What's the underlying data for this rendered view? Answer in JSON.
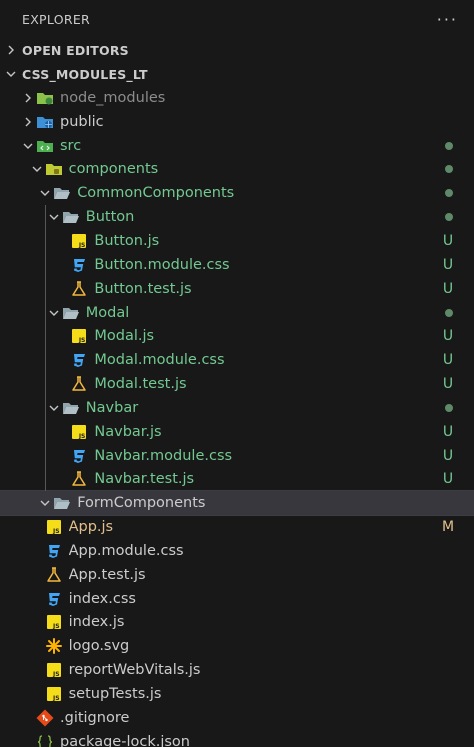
{
  "header": {
    "title": "EXPLORER",
    "more": "···"
  },
  "sections": {
    "open_editors": "OPEN EDITORS",
    "project": "CSS_MODULES_LT"
  },
  "colors": {
    "untracked": "#73c991",
    "modified": "#e2c08d",
    "muted": "#8c8c8c",
    "dot": "#6e6e6e"
  },
  "tree": [
    {
      "label": "node_modules",
      "depth": 1,
      "kind": "folder",
      "icon": "node-folder-icon",
      "open": false,
      "tone": "muted"
    },
    {
      "label": "public",
      "depth": 1,
      "kind": "folder",
      "icon": "public-folder-icon",
      "open": false,
      "tone": "plain"
    },
    {
      "label": "src",
      "depth": 1,
      "kind": "folder",
      "icon": "src-folder-icon",
      "open": true,
      "tone": "untracked",
      "dot": true
    },
    {
      "label": "components",
      "depth": 2,
      "kind": "folder",
      "icon": "components-folder-icon",
      "open": true,
      "tone": "untracked",
      "dot": true
    },
    {
      "label": "CommonComponents",
      "depth": 3,
      "kind": "folder",
      "icon": "folder-open-icon",
      "open": true,
      "tone": "untracked",
      "dot": true
    },
    {
      "label": "Button",
      "depth": 4,
      "kind": "folder",
      "icon": "folder-open-icon",
      "open": true,
      "tone": "untracked",
      "dot": true
    },
    {
      "label": "Button.js",
      "depth": 5,
      "kind": "file",
      "icon": "js-file-icon",
      "tone": "untracked",
      "status": "U"
    },
    {
      "label": "Button.module.css",
      "depth": 5,
      "kind": "file",
      "icon": "css-file-icon",
      "tone": "untracked",
      "status": "U"
    },
    {
      "label": "Button.test.js",
      "depth": 5,
      "kind": "file",
      "icon": "test-file-icon",
      "tone": "untracked",
      "status": "U"
    },
    {
      "label": "Modal",
      "depth": 4,
      "kind": "folder",
      "icon": "folder-open-icon",
      "open": true,
      "tone": "untracked",
      "dot": true
    },
    {
      "label": "Modal.js",
      "depth": 5,
      "kind": "file",
      "icon": "js-file-icon",
      "tone": "untracked",
      "status": "U"
    },
    {
      "label": "Modal.module.css",
      "depth": 5,
      "kind": "file",
      "icon": "css-file-icon",
      "tone": "untracked",
      "status": "U"
    },
    {
      "label": "Modal.test.js",
      "depth": 5,
      "kind": "file",
      "icon": "test-file-icon",
      "tone": "untracked",
      "status": "U"
    },
    {
      "label": "Navbar",
      "depth": 4,
      "kind": "folder",
      "icon": "folder-open-icon",
      "open": true,
      "tone": "untracked",
      "dot": true
    },
    {
      "label": "Navbar.js",
      "depth": 5,
      "kind": "file",
      "icon": "js-file-icon",
      "tone": "untracked",
      "status": "U"
    },
    {
      "label": "Navbar.module.css",
      "depth": 5,
      "kind": "file",
      "icon": "css-file-icon",
      "tone": "untracked",
      "status": "U"
    },
    {
      "label": "Navbar.test.js",
      "depth": 5,
      "kind": "file",
      "icon": "test-file-icon",
      "tone": "untracked",
      "status": "U"
    },
    {
      "label": "FormComponents",
      "depth": 3,
      "kind": "folder",
      "icon": "folder-open-icon",
      "open": true,
      "tone": "plain",
      "selected": true
    },
    {
      "label": "App.js",
      "depth": 2,
      "kind": "file",
      "icon": "js-file-icon",
      "tone": "modified",
      "status": "M"
    },
    {
      "label": "App.module.css",
      "depth": 2,
      "kind": "file",
      "icon": "css-file-icon",
      "tone": "plain"
    },
    {
      "label": "App.test.js",
      "depth": 2,
      "kind": "file",
      "icon": "test-file-icon",
      "tone": "plain"
    },
    {
      "label": "index.css",
      "depth": 2,
      "kind": "file",
      "icon": "css-file-icon",
      "tone": "plain"
    },
    {
      "label": "index.js",
      "depth": 2,
      "kind": "file",
      "icon": "js-file-icon",
      "tone": "plain"
    },
    {
      "label": "logo.svg",
      "depth": 2,
      "kind": "file",
      "icon": "svg-file-icon",
      "tone": "plain"
    },
    {
      "label": "reportWebVitals.js",
      "depth": 2,
      "kind": "file",
      "icon": "js-file-icon",
      "tone": "plain"
    },
    {
      "label": "setupTests.js",
      "depth": 2,
      "kind": "file",
      "icon": "js-file-icon",
      "tone": "plain"
    },
    {
      "label": ".gitignore",
      "depth": 1,
      "kind": "file",
      "icon": "git-file-icon",
      "tone": "plain"
    },
    {
      "label": "package-lock.json",
      "depth": 1,
      "kind": "file",
      "icon": "json-file-icon",
      "tone": "plain"
    }
  ]
}
